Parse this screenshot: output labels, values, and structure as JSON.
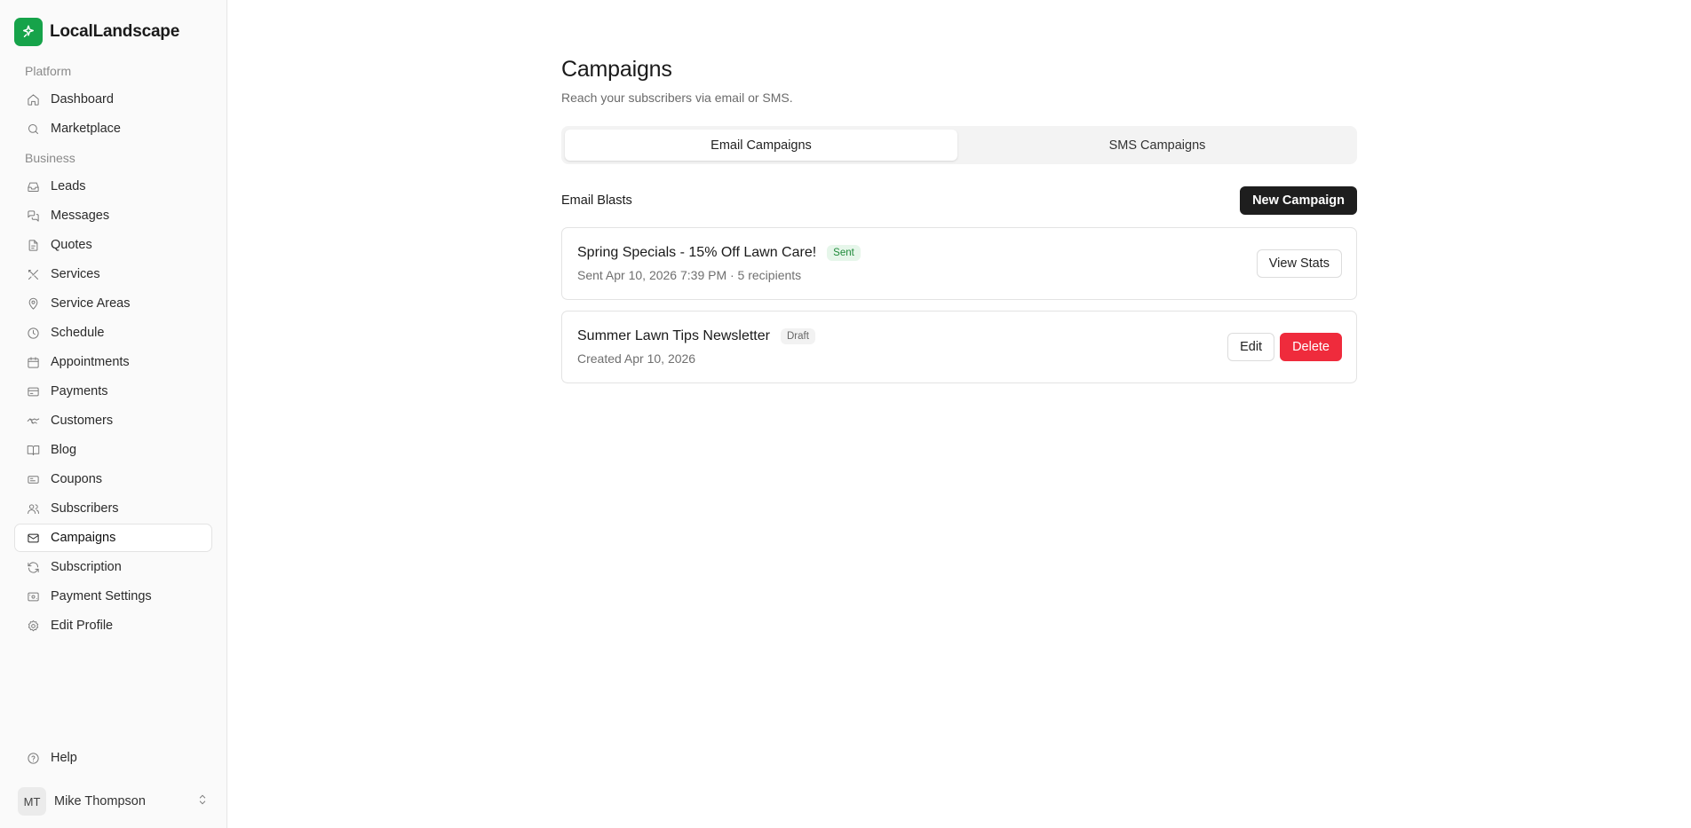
{
  "brand": {
    "name": "LocalLandscape",
    "logo_color": "#16a34a"
  },
  "sidebar": {
    "platform_label": "Platform",
    "platform_items": [
      {
        "label": "Dashboard",
        "icon": "home-icon"
      },
      {
        "label": "Marketplace",
        "icon": "search-icon"
      }
    ],
    "business_label": "Business",
    "business_items": [
      {
        "label": "Leads",
        "icon": "inbox-icon"
      },
      {
        "label": "Messages",
        "icon": "messages-icon"
      },
      {
        "label": "Quotes",
        "icon": "file-icon"
      },
      {
        "label": "Services",
        "icon": "tools-icon"
      },
      {
        "label": "Service Areas",
        "icon": "map-pin-icon"
      },
      {
        "label": "Schedule",
        "icon": "clock-icon"
      },
      {
        "label": "Appointments",
        "icon": "calendar-icon"
      },
      {
        "label": "Payments",
        "icon": "credit-card-icon"
      },
      {
        "label": "Customers",
        "icon": "handshake-icon"
      },
      {
        "label": "Blog",
        "icon": "book-icon"
      },
      {
        "label": "Coupons",
        "icon": "ticket-icon"
      },
      {
        "label": "Subscribers",
        "icon": "users-icon"
      },
      {
        "label": "Campaigns",
        "icon": "mail-icon",
        "active": true
      },
      {
        "label": "Subscription",
        "icon": "refresh-icon"
      },
      {
        "label": "Payment Settings",
        "icon": "wallet-icon"
      },
      {
        "label": "Edit Profile",
        "icon": "gear-icon"
      }
    ],
    "help_label": "Help",
    "user": {
      "initials": "MT",
      "name": "Mike Thompson"
    }
  },
  "page": {
    "title": "Campaigns",
    "subtitle": "Reach your subscribers via email or SMS.",
    "tabs": [
      {
        "label": "Email Campaigns",
        "active": true
      },
      {
        "label": "SMS Campaigns",
        "active": false
      }
    ],
    "section_title": "Email Blasts",
    "new_button": "New Campaign"
  },
  "campaigns": [
    {
      "title": "Spring Specials - 15% Off Lawn Care!",
      "status": "Sent",
      "meta": "Sent Apr 10, 2026 7:39 PM · 5 recipients",
      "actions": {
        "view_stats": "View Stats"
      }
    },
    {
      "title": "Summer Lawn Tips Newsletter",
      "status": "Draft",
      "meta": "Created Apr 10, 2026",
      "actions": {
        "edit": "Edit",
        "delete": "Delete"
      }
    }
  ],
  "colors": {
    "accent": "#16a34a",
    "dark_button": "#1e1e1e",
    "danger": "#ef2b3c",
    "sent_badge_bg": "#e6f6ea",
    "sent_badge_text": "#1f8a3a"
  }
}
